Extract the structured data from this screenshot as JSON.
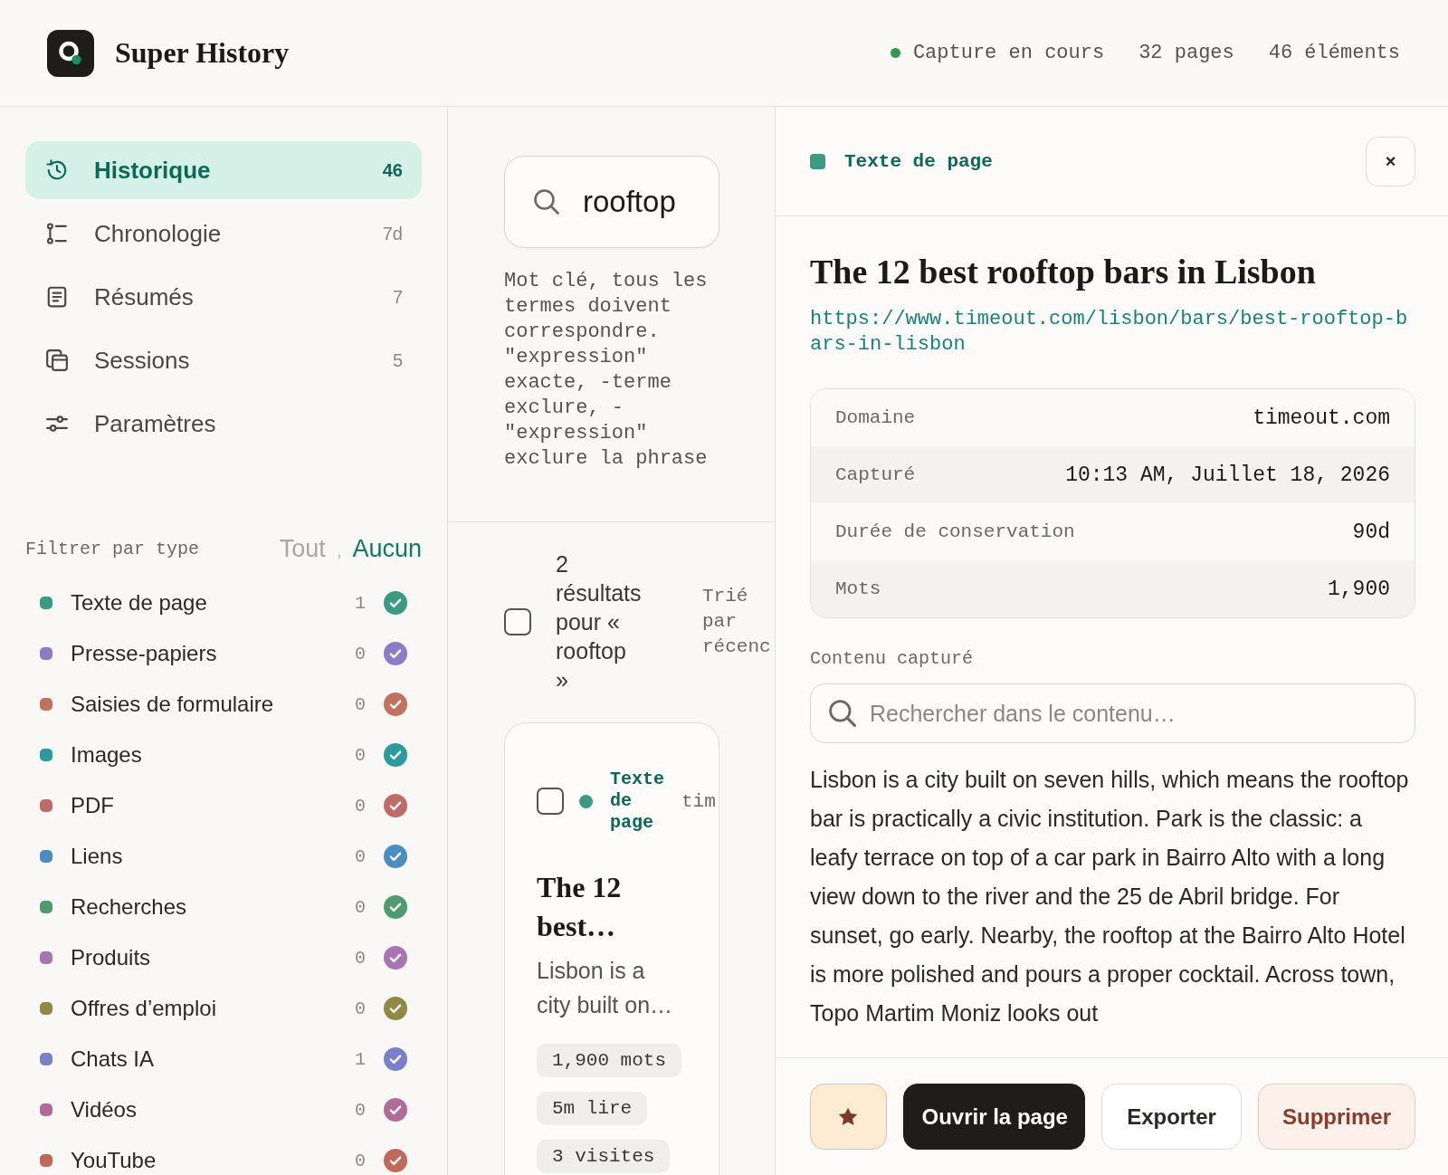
{
  "app": {
    "title": "Super History"
  },
  "status": {
    "capturing": true,
    "label": "Capture en cours",
    "pages": "32 pages",
    "items": "46 éléments"
  },
  "sidebar": {
    "nav": [
      {
        "label": "Historique",
        "count": "46",
        "selected": true
      },
      {
        "label": "Chronologie",
        "count": "7d",
        "selected": false
      },
      {
        "label": "Résumés",
        "count": "7",
        "selected": false
      },
      {
        "label": "Sessions",
        "count": "5",
        "selected": false
      },
      {
        "label": "Paramètres",
        "selected": false
      }
    ],
    "filter": {
      "title": "Filtrer par type",
      "all": {
        "label": "Tout",
        "disabled": true
      },
      "separator": ",",
      "none": {
        "label": "Aucun",
        "disabled": false
      },
      "types": [
        {
          "label": "Texte de page",
          "count": "1",
          "color": "#3a9a82",
          "checked": true
        },
        {
          "label": "Presse-papiers",
          "count": "0",
          "color": "#8c7bc6",
          "checked": true
        },
        {
          "label": "Saisies de formulaire",
          "count": "0",
          "color": "#c2715f",
          "checked": true
        },
        {
          "label": "Images",
          "count": "0",
          "color": "#2a9a9f",
          "checked": true
        },
        {
          "label": "PDF",
          "count": "0",
          "color": "#c06a6a",
          "checked": true
        },
        {
          "label": "Liens",
          "count": "0",
          "color": "#4a8dc6",
          "checked": true
        },
        {
          "label": "Recherches",
          "count": "0",
          "color": "#4e9b6f",
          "checked": true
        },
        {
          "label": "Produits",
          "count": "0",
          "color": "#a874b1",
          "checked": true
        },
        {
          "label": "Offres d’emploi",
          "count": "0",
          "color": "#918842",
          "checked": true
        },
        {
          "label": "Chats IA",
          "count": "1",
          "color": "#7b80cc",
          "checked": true
        },
        {
          "label": "Vidéos",
          "count": "0",
          "color": "#b06b99",
          "checked": true
        },
        {
          "label": "YouTube",
          "count": "0",
          "color": "#c1685b",
          "checked": true
        }
      ]
    }
  },
  "search": {
    "value": "rooftop",
    "help": "Mot clé, tous les termes doivent correspondre. \"expression\" exacte, -terme exclure, -\"expression\" exclure la phrase"
  },
  "results": {
    "select_all_checked": false,
    "summary": "2 résultats pour « rooftop »",
    "sort": "Trié par récenc",
    "cards": [
      {
        "checked": false,
        "type": "Texte de page",
        "color": "#3a9a82",
        "column_3": "tim",
        "title": "The 12 best…",
        "snippet": "Lisbon is a city built on…",
        "tags": [
          "1,900 mots",
          "5m lire",
          "3 visites"
        ]
      }
    ]
  },
  "detail": {
    "type": "Texte de page",
    "color": "#3a9a82",
    "close": "×",
    "title": "The 12 best rooftop bars in Lisbon",
    "url": "https://www.timeout.com/lisbon/bars/best-rooftop-bars-in-lisbon",
    "meta": [
      {
        "label": "Domaine",
        "value": "timeout.com"
      },
      {
        "label": "Capturé",
        "value": "10:13 AM, Juillet 18, 2026"
      },
      {
        "label": "Durée de conservation",
        "value": "90d"
      },
      {
        "label": "Mots",
        "value": "1,900"
      }
    ],
    "content_label": "Contenu capturé",
    "content_search": {
      "placeholder": "Rechercher dans le contenu…"
    },
    "content": "Lisbon is a city built on seven hills, which means the rooftop bar is practically a civic institution. Park is the classic: a leafy terrace on top of a car park in Bairro Alto with a long view down to the river and the 25 de Abril bridge. For sunset, go early. Nearby, the rooftop at the Bairro Alto Hotel is more polished and pours a proper cocktail. Across town, Topo Martim Moniz looks out",
    "starred": true,
    "actions": [
      {
        "label": "Ouvrir la page",
        "kind": "primary"
      },
      {
        "label": "Exporter",
        "kind": "secondary"
      },
      {
        "label": "Supprimer",
        "kind": "danger"
      }
    ]
  }
}
